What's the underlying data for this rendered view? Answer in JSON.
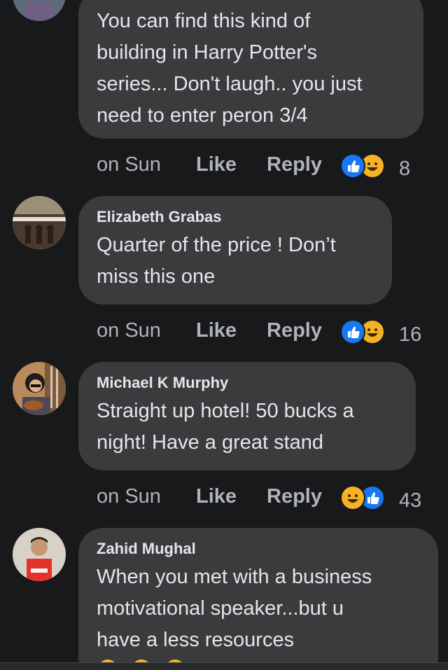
{
  "comments": [
    {
      "author": "",
      "text": "You can find this kind of\nbuilding in Harry Potter's\nseries... Don't laugh.. you just\nneed to enter peron 3/4",
      "time": "on Sun",
      "like": "Like",
      "reply": "Reply",
      "reactions": [
        "like-icon",
        "haha-icon"
      ],
      "count": "8"
    },
    {
      "author": "Elizabeth Grabas",
      "text": "Quarter of the price ! Don’t\nmiss this one",
      "time": "on Sun",
      "like": "Like",
      "reply": "Reply",
      "reactions": [
        "like-icon",
        "haha-icon"
      ],
      "count": "16"
    },
    {
      "author": "Michael K Murphy",
      "text": "Straight up hotel! 50 bucks a\nnight! Have a great stand",
      "time": "on Sun",
      "like": "Like",
      "reply": "Reply",
      "reactions": [
        "haha-icon",
        "like-icon"
      ],
      "count": "43"
    },
    {
      "author": "Zahid Mughal",
      "text": "When you met with a business\nmotivational speaker...but u\nhave a less resources",
      "time": "",
      "like": "",
      "reply": "",
      "reactions": [],
      "count": ""
    }
  ],
  "colors": {
    "background": "#18191a",
    "bubble": "#3a3b3c",
    "text": "#e4e6eb",
    "secondary": "#b0b3b8",
    "like_blue": "#1877f2",
    "haha_yellow": "#f7b125"
  }
}
